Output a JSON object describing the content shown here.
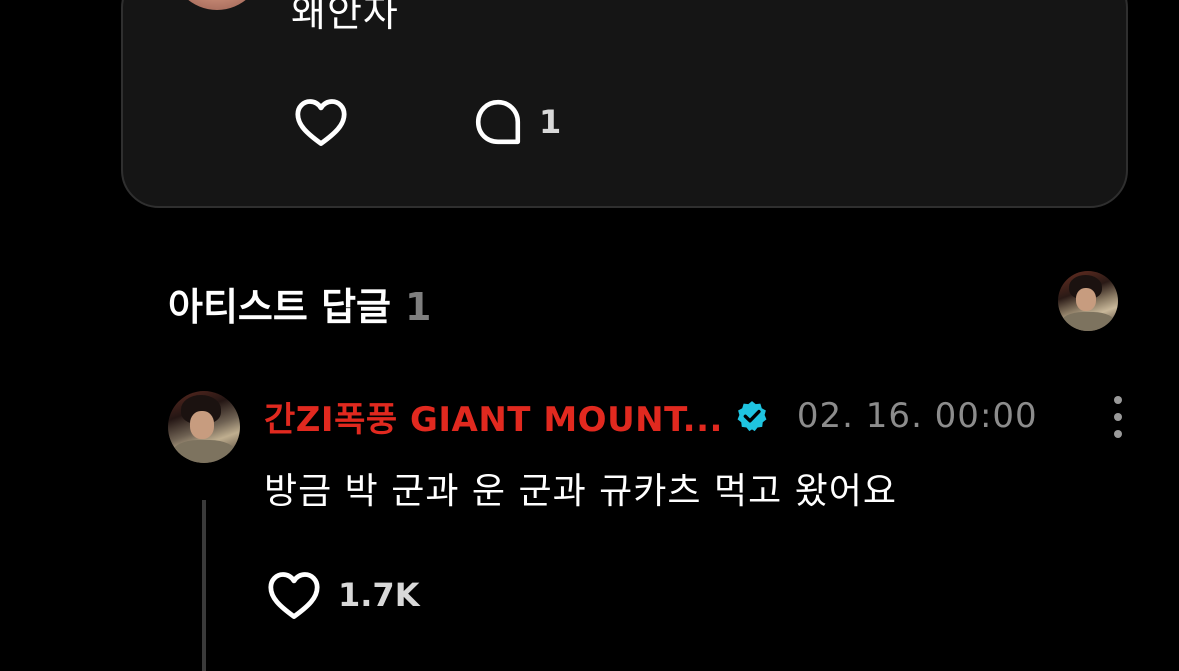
{
  "post": {
    "text": "왜안자",
    "comment_count": "1",
    "icons": {
      "like": "heart-outline-icon",
      "comment": "speech-bubble-icon"
    }
  },
  "artist_replies": {
    "title": "아티스트 답글",
    "count": "1"
  },
  "reply": {
    "author": "간ZI폭풍 GIANT MOUNT...",
    "verified": true,
    "timestamp": "02. 16. 00:00",
    "text": "방금 박 군과 운 군과 규카츠 먹고 왔어요",
    "like_count": "1.7K",
    "icons": {
      "verified": "verified-badge-icon",
      "more": "more-vertical-icon",
      "like": "heart-outline-icon"
    }
  },
  "colors": {
    "background": "#000000",
    "card_background": "#151515",
    "card_border": "#2f2f2f",
    "author_red": "#e1291f",
    "verified_cyan": "#1fc4e0",
    "muted_gray": "#8c8c8c"
  }
}
